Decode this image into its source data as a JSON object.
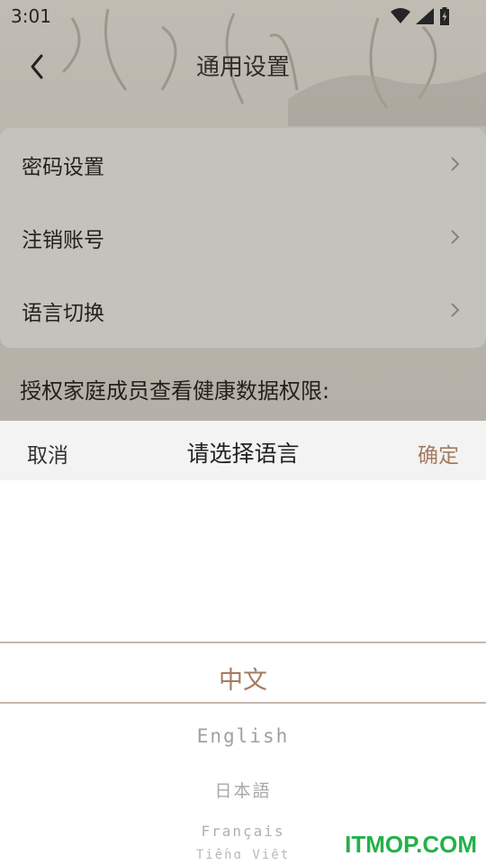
{
  "status_bar": {
    "time": "3:01",
    "icons": [
      "wifi-icon",
      "signal-icon",
      "battery-icon"
    ]
  },
  "header": {
    "title": "通用设置",
    "back_icon": "chevron-left-icon"
  },
  "settings": {
    "items": [
      {
        "label": "密码设置"
      },
      {
        "label": "注销账号"
      },
      {
        "label": "语言切换"
      }
    ],
    "permission_label": "授权家庭成员查看健康数据权限:"
  },
  "language_picker": {
    "cancel_label": "取消",
    "title": "请选择语言",
    "confirm_label": "确定",
    "selected": "中文",
    "options": [
      "English",
      "日本語",
      "Français",
      "Tiếng Việt"
    ]
  },
  "watermark": "ITMOP.COM",
  "colors": {
    "accent": "#a57b5f",
    "watermark": "#24b14a"
  }
}
